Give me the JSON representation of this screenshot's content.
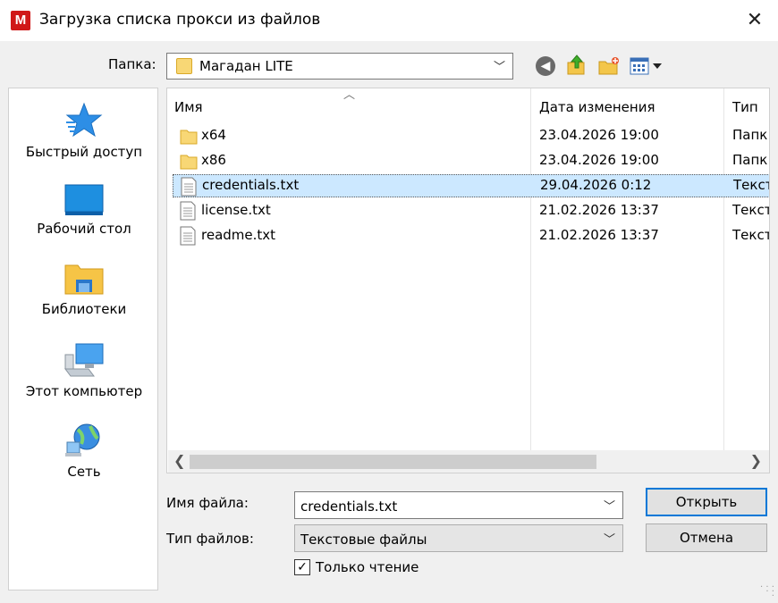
{
  "window": {
    "title": "Загрузка списка прокси из файлов",
    "app_icon_letter": "M",
    "close_glyph": "✕"
  },
  "folder_bar": {
    "label": "Папка:",
    "current": "Магадан LITE"
  },
  "places": [
    {
      "label": "Быстрый доступ",
      "icon": "star-icon"
    },
    {
      "label": "Рабочий стол",
      "icon": "desktop-icon"
    },
    {
      "label": "Библиотеки",
      "icon": "libraries-icon"
    },
    {
      "label": "Этот компьютер",
      "icon": "computer-icon"
    },
    {
      "label": "Сеть",
      "icon": "network-icon"
    }
  ],
  "file_list": {
    "columns": [
      "Имя",
      "Дата изменения",
      "Тип"
    ],
    "rows": [
      {
        "name": "x64",
        "date": "23.04.2026 19:00",
        "type": "Папк",
        "kind": "folder"
      },
      {
        "name": "x86",
        "date": "23.04.2026 19:00",
        "type": "Папк",
        "kind": "folder"
      },
      {
        "name": "credentials.txt",
        "date": "29.04.2026 0:12",
        "type": "Текст",
        "kind": "file",
        "selected": true
      },
      {
        "name": "license.txt",
        "date": "21.02.2026 13:37",
        "type": "Текст",
        "kind": "file"
      },
      {
        "name": "readme.txt",
        "date": "21.02.2026 13:37",
        "type": "Текст",
        "kind": "file"
      }
    ]
  },
  "bottom": {
    "filename_label": "Имя файла:",
    "filename_value": "credentials.txt",
    "filetype_label": "Тип файлов:",
    "filetype_value": "Текстовые файлы",
    "open_label": "Открыть",
    "cancel_label": "Отмена",
    "readonly_label": "Только чтение",
    "readonly_checked": true
  },
  "colors": {
    "accent": "#0078d7",
    "selection": "#cce8ff",
    "app_icon": "#d01818"
  }
}
